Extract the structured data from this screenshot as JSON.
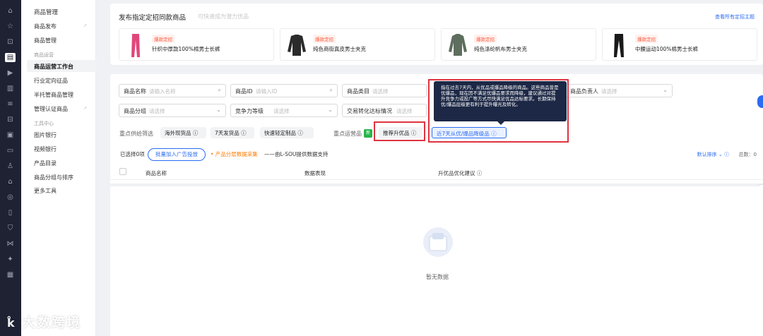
{
  "iconbar": {
    "icons": [
      "home-icon",
      "star-icon",
      "bag-icon",
      "store-icon",
      "video-icon",
      "chart-icon",
      "list-icon",
      "ticket-icon",
      "ad-icon",
      "message-icon",
      "user-icon",
      "shop-icon",
      "globe-icon",
      "wallet-icon",
      "shield-icon",
      "network-icon",
      "sparkle-icon",
      "tool-icon"
    ]
  },
  "sidebar": {
    "section_title": "商品管理",
    "items_top": [
      "商品发布",
      "商品管理"
    ],
    "group_ops": "商品运营",
    "items_ops": [
      "商品运营工作台",
      "行业定向征品",
      "半托管商品管理",
      "管理认证商品"
    ],
    "group_tools": "工具中心",
    "items_tools": [
      "图片银行",
      "视频银行",
      "产品目录",
      "商品分组与排序",
      "更多工具"
    ]
  },
  "promo": {
    "title": "发布指定定招同款商品",
    "subtitle": "可快速成为潜力优品",
    "link": "查看所有定招主题",
    "badge": "爆款定招",
    "cards": [
      {
        "name": "针织中厚款100%棉男士长裤",
        "color": "#e0467a"
      },
      {
        "name": "纯色商街真皮男士夹克",
        "color": "#2b2b2b"
      },
      {
        "name": "纯色涤纶帆布男士夹克",
        "color": "#5e6e5f"
      },
      {
        "name": "中腰运动100%棉男士长裤",
        "color": "#1a1a1a"
      }
    ]
  },
  "filters": {
    "row1": [
      {
        "label": "商品名称",
        "placeholder": "请输入名称"
      },
      {
        "label": "商品ID",
        "placeholder": "请输入ID"
      },
      {
        "label": "商品类目",
        "placeholder": "请选择"
      },
      {
        "label": "商品负责人",
        "placeholder": "请选择"
      }
    ],
    "row2": [
      {
        "label": "商品分组",
        "placeholder": "请选择"
      },
      {
        "label": "竞争力等级",
        "placeholder": "请选择"
      },
      {
        "label": "交易转化达标情况",
        "placeholder": "请选择"
      }
    ]
  },
  "quick": {
    "supply_label": "重点供给筛选",
    "supply_chips": [
      "海外现货品",
      "7天发货品",
      "快速轻定制品"
    ],
    "ops_label": "重点运营品",
    "new_tag": "新",
    "ops_chips": [
      "推荐升优品",
      "近7天从优/爆品降级品"
    ]
  },
  "tooltip": "指在过去7天内，从优品或爆品降级的商品。这些商品曾是优爆品，现在因不满足优爆品要求而降级，建议通过对提升竞争力或投广等方式尽快满足优品达标要求。长期保持优/爆品层级更有利于提升曝光及转化。",
  "toolbar": {
    "selected": "已选择0项",
    "ad_button": "批量加入广告投放",
    "collect": "• 产品分层数据采集",
    "support": "——由L-SOU提供数据支持",
    "sort": "默认排序",
    "total": "总数：0"
  },
  "table": {
    "headers": [
      "商品名称",
      "数据表现",
      "升优品优化建议"
    ]
  },
  "empty": "暂无数据",
  "watermark": "大数跨境"
}
